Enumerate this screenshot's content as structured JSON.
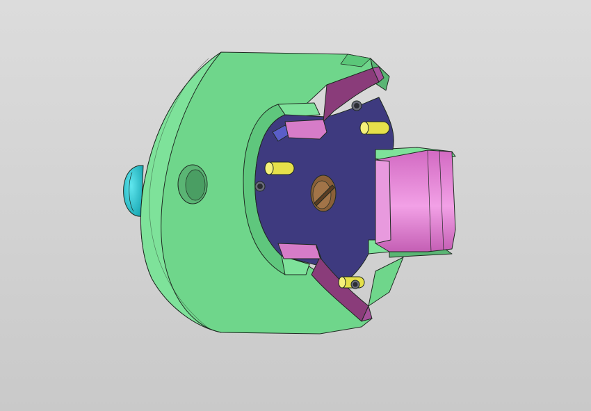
{
  "viewport": {
    "background_top": "#dcdcdc",
    "background_bottom": "#c9c9c9"
  },
  "model": {
    "parts": [
      {
        "name": "housing",
        "color": "#72d98e"
      },
      {
        "name": "inner-disc",
        "color": "#3f3b80"
      },
      {
        "name": "clamp-jaws",
        "color": "#d67cc8"
      },
      {
        "name": "jaw-rails",
        "color": "#8a3c7a"
      },
      {
        "name": "shaft",
        "color": "#e07ad0"
      },
      {
        "name": "pins",
        "color": "#e6e04a"
      },
      {
        "name": "center-screw",
        "color": "#8a6038"
      },
      {
        "name": "end-knob",
        "color": "#26c8d4"
      }
    ]
  }
}
